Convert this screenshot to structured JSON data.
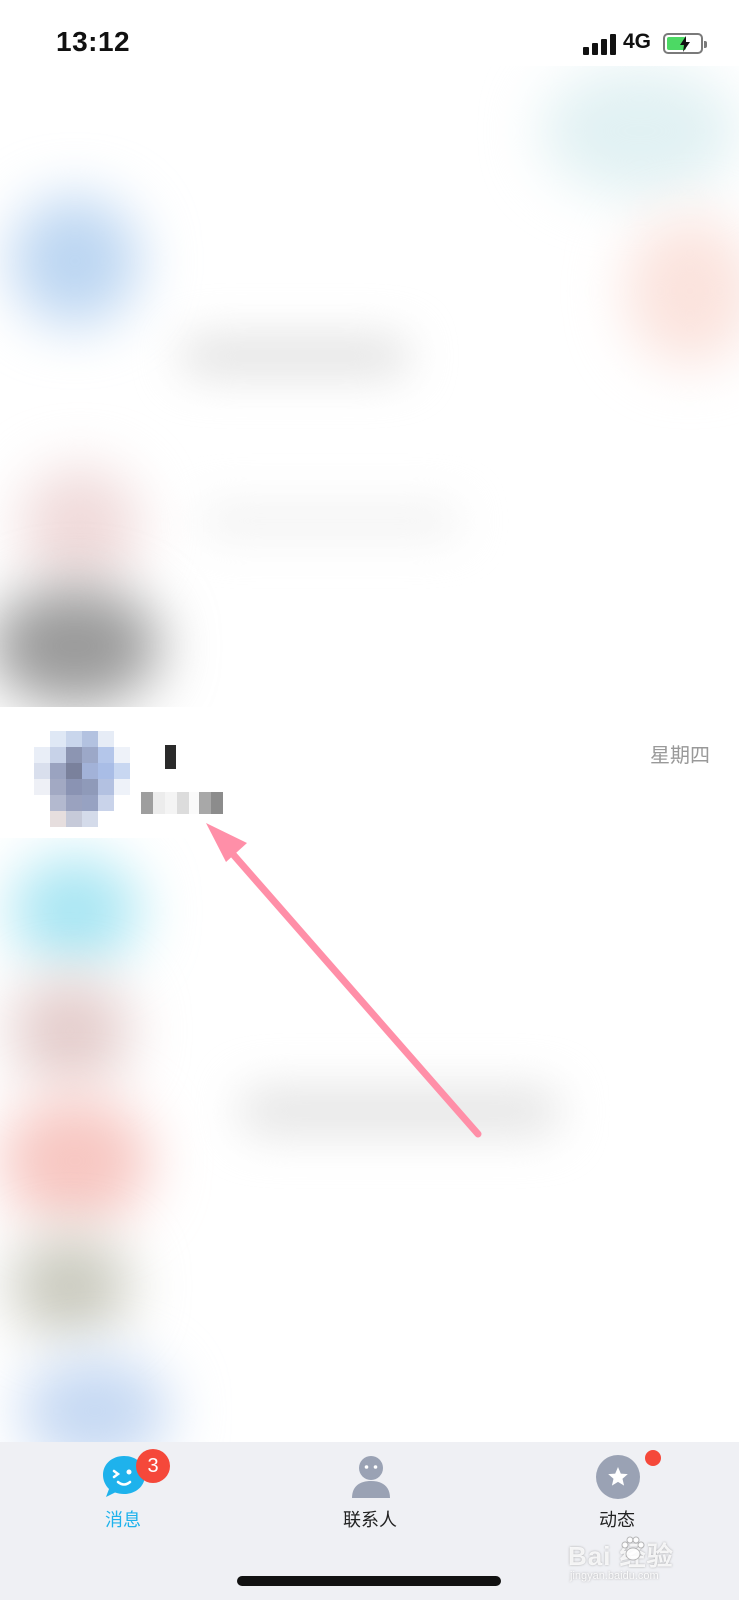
{
  "status_bar": {
    "time": "13:12",
    "network": "4G",
    "battery_fill_fraction": 0.6
  },
  "focused_chat": {
    "time_label": "星期四"
  },
  "annotation": {
    "color": "#ff8fa8"
  },
  "tab_bar": {
    "tabs": [
      {
        "label": "消息",
        "icon": "message-bubble-icon",
        "badge": "3",
        "active": true
      },
      {
        "label": "联系人",
        "icon": "contacts-person-icon",
        "active": false
      },
      {
        "label": "动态",
        "icon": "star-feed-icon",
        "has_dot": true,
        "active": false
      }
    ],
    "active_color": "#1eb2ec",
    "badge_color": "#f5483a"
  },
  "watermark": {
    "brand": "Bai  经验",
    "url": "jingyan.baidu.com"
  }
}
